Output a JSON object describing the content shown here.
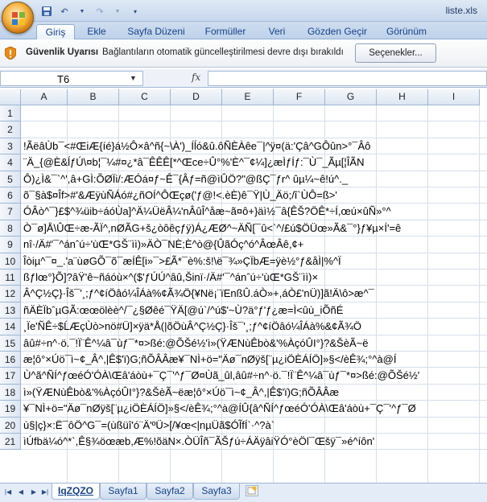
{
  "window": {
    "title": "liste.xls"
  },
  "ribbon": {
    "tabs": [
      {
        "label": "Giriş"
      },
      {
        "label": "Ekle"
      },
      {
        "label": "Sayfa Düzeni"
      },
      {
        "label": "Formüller"
      },
      {
        "label": "Veri"
      },
      {
        "label": "Gözden Geçir"
      },
      {
        "label": "Görünüm"
      }
    ]
  },
  "security_bar": {
    "title": "Güvenlik Uyarısı",
    "message": "Bağlantıların otomatik güncelleştirilmesi devre dışı bırakıldı",
    "button_label": "Seçenekler..."
  },
  "formula_bar": {
    "name_box": "T6",
    "fx_label": "fx",
    "formula": ""
  },
  "grid": {
    "columns": [
      "A",
      "B",
      "C",
      "D",
      "E",
      "F",
      "G",
      "H",
      "I"
    ],
    "rows": [
      {
        "num": "1",
        "text": ""
      },
      {
        "num": "2",
        "text": ""
      },
      {
        "num": "3",
        "text": "!ÃëâÙb¯<#ŒiÆ{íé}á½Ô×â^ñ{~\\À')_Íĺó&û.ôÑÈÀêe¯|^ÿ¤(ä:'Çâ^GÔûn>°¯Âô"
      },
      {
        "num": "4",
        "text": "¨Ä_{@È&ĺƒÚ\\¤b¦¯¼#¤¿*â¯ÊÊÊ[*^Œce÷Û°%'È^¯¢¼]¿æÌƒÍƒ:¯Ù¯_Ãµ[¦ÎÃN"
      },
      {
        "num": "5",
        "text": "Ô)¿Ì&¯`^',â+GÌ:ÕØÏi/:ÆÓá¤ƒ~Ê¯{Âƒ=ñ@ìÛÖ?\"@ßÇ¯ƒr^ ûµ¼~ê!ú^._"
      },
      {
        "num": "6",
        "text": "õ¯§à$¤Îf>#'&ÆÿùÑÁó#¿ñOÍ^ÔŒçø('ƒ@!<.èÈ)ê¯Ÿ|Ù_Äö;/î`ÙÔ=ß>'"
      },
      {
        "num": "7",
        "text": "ÓÂò^¯}£$^¾üib÷áóÙa]^Ä¼ÜëÂ¼'nÂûÎ^åæ~ã¤ô+}äì½¯â{ÊŠ?ÖÊ*÷Í,œú×ûÑ»°^"
      },
      {
        "num": "8",
        "text": "Ò¯ø]Å\\ÛŒ÷æ-ÃÏ^,nØÃG+š¿òôêçƒÿ)Á¿ÆØ^~ÄÑ[¯û<`^/£ú$ÖÜœ»Ã&¯°}ƒ¥µ×Í'=ê"
      },
      {
        "num": "9",
        "text": "nî·/Ä#'¯^ánˆú÷'ùŒ*GŠ¨ìì)»ÄÒ¯NÈ;È^ò@{ÛãÓç^ó^ÂœÂê,¢+"
      },
      {
        "num": "10",
        "text": "Îòiµ^¯¤_.'a¨ùøGÕ¯õ¯æÍÊ[i»¯>£Ã*¯è%:š!\\ë¯¾»ÇÏbÆ=ÿè½°ƒ&åÌ|%^Ï"
      },
      {
        "num": "11",
        "text": "ßƒlœ°}Õ]?âŸ'ê~ñáóù×^($'ƒÚÚ^âû,Šinï·/Ä#'¯^ánˆú÷'ùŒ*GŠ¨ìì)×"
      },
      {
        "num": "12",
        "text": "Â^Ç½Ç}·Îš¯'¸;ƒ^¢íÖâó¼ÎÁà%¢Ã¾Ö{¥Në¡¨ïEnßÛ.áÒ»+,áÒ£'nÜ)]ã!Ä\\ô>æ^¯"
      },
      {
        "num": "13",
        "text": "ñÄÈÏbˆµGÃ:œœölèè^/¯¿§Øêé¯ŸÄ[@ú`/^ú$'~Ù?ä°ƒ'ƒ¿æ=Ì<ûù_iÕñÉ"
      },
      {
        "num": "14",
        "text": "¸Ïe'ÑÊ÷$ĹÆçÙò>nö#Ü]×ÿä*Å(|õÖùÂ^Ç½Ç}·Îš¯'¸;ƒ^¢íÖâó¼ÎÁà%&¢Ã¾Ö"
      },
      {
        "num": "15",
        "text": "âû#÷n^·ö.¯!Ï¨Ê^¼â¯ùƒ¯*¤>ßé:@ÕŠé½'ì»(ŸÆNùÊbò&'%ÀçóÛI°}?&ŠèÃ~ë"
      },
      {
        "num": "16",
        "text": "æ¦ô°×Úö¯ì~¢_Â^,|Ê$'ï)G;ñÕÂÂæ¥¯NÌ+ö=\"Äø¯nØÿš[¨µ¿iÖÈÁÍÖ]»§</èÊ¾;°^à@Í"
      },
      {
        "num": "17",
        "text": "Ù^ã^ÑÍ^ƒœéÓ'ÓÀ\\Œâ'áòù+¯Ç¯'^ƒ¯Ø¤Ùã_ûl,âû#÷n^·ö.¯!Ï¨Ê^¼â¯ùƒ¯*¤>ßé:@ÕŠé½'"
      },
      {
        "num": "18",
        "text": "ì»(ŸÆNùÊbò&'%ÀçóÛI°}?&ŠèÃ~ëæ¦ô°×Úö¯ì~¢_Â^,|Ê$'ï)G;ñÕÂÂæ"
      },
      {
        "num": "19",
        "text": "¥¯NÌ+ö=\"Äø¯nØÿš[¨µ¿iÖÈÁÍÖ]»§</èÊ¾;°^à@ÍÛ{â^ÑÍ^ƒœéÓ'ÓÀ\\Œâ'áòù+¯Ç¯'^ƒ¯Ø"
      },
      {
        "num": "20",
        "text": "ù§|ç}×:Ë¯ôÖ^G¯=(ùßüî'ó¨Ä'ºÜ>[/¥œ<|nµÜã$ÓĨfÍ`·^?à`"
      },
      {
        "num": "21",
        "text": "ìÚfbä¼ó^*`,Ê§¾öœæb,Æ%!õäN×.ÒÜÎñ¯ÃŠƒú÷ÁÄÿâiŸÓ°èÖl¯Œšÿ¯»é^íôn'"
      }
    ]
  },
  "sheets": {
    "tabs": [
      {
        "label": "IqZQZO",
        "active": true
      },
      {
        "label": "Sayfa1",
        "active": false
      },
      {
        "label": "Sayfa2",
        "active": false
      },
      {
        "label": "Sayfa3",
        "active": false
      }
    ]
  }
}
